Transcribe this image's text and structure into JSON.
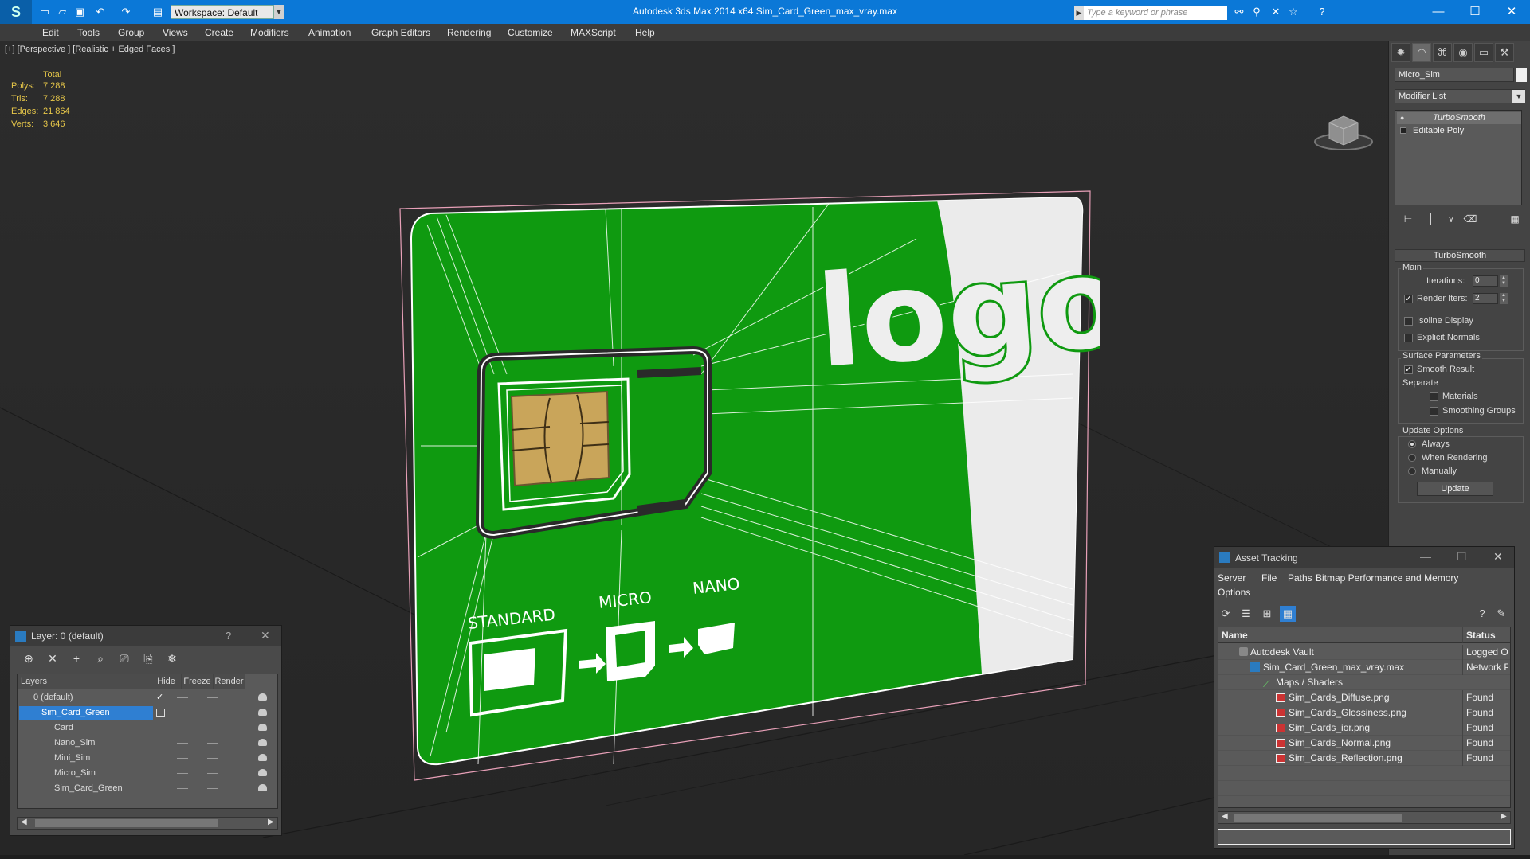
{
  "titlebar": {
    "workspace": "Workspace: Default",
    "title": "Autodesk 3ds Max  2014 x64      Sim_Card_Green_max_vray.max",
    "search_placeholder": "Type a keyword or phrase"
  },
  "menu": [
    "Edit",
    "Tools",
    "Group",
    "Views",
    "Create",
    "Modifiers",
    "Animation",
    "Graph Editors",
    "Rendering",
    "Customize",
    "MAXScript",
    "Help"
  ],
  "viewport": {
    "label": "[+] [Perspective ] [Realistic + Edged Faces ]",
    "stats": {
      "header": "Total",
      "rows": [
        {
          "label": "Polys:",
          "value": "7 288"
        },
        {
          "label": "Tris:",
          "value": "7 288"
        },
        {
          "label": "Edges:",
          "value": "21 864"
        },
        {
          "label": "Verts:",
          "value": "3 646"
        }
      ]
    },
    "card": {
      "logo_text": "logo",
      "standard_label": "STANDARD",
      "micro_label": "MICRO",
      "nano_label": "NANO",
      "green": "#0f9a10",
      "white": "#ebebeb"
    }
  },
  "command_panel": {
    "object_name": "Micro_Sim",
    "modifier_list": "Modifier List",
    "stack": [
      "TurboSmooth",
      "Editable Poly"
    ],
    "rollout_title": "TurboSmooth",
    "main_group": "Main",
    "iterations_label": "Iterations:",
    "iterations_value": "0",
    "render_iters_label": "Render Iters:",
    "render_iters_value": "2",
    "isoline_display": "Isoline Display",
    "explicit_normals": "Explicit Normals",
    "surface_params": "Surface Parameters",
    "smooth_result": "Smooth Result",
    "separate": "Separate",
    "materials": "Materials",
    "smoothing_groups": "Smoothing Groups",
    "update_options": "Update Options",
    "always": "Always",
    "when_rendering": "When Rendering",
    "manually": "Manually",
    "update_button": "Update"
  },
  "layer_dialog": {
    "title": "Layer: 0 (default)",
    "help": "?",
    "columns": {
      "layers": "Layers",
      "hide": "Hide",
      "freeze": "Freeze",
      "render": "Render"
    },
    "rows": [
      {
        "name": "0 (default)"
      },
      {
        "name": "Sim_Card_Green"
      },
      {
        "name": "Card"
      },
      {
        "name": "Nano_Sim"
      },
      {
        "name": "Mini_Sim"
      },
      {
        "name": "Micro_Sim"
      },
      {
        "name": "Sim_Card_Green"
      }
    ]
  },
  "asset_tracking": {
    "title": "Asset Tracking",
    "menu": [
      "Server",
      "File",
      "Paths",
      "Bitmap Performance and Memory"
    ],
    "menu2": "Options",
    "columns": {
      "name": "Name",
      "status": "Status"
    },
    "rows": [
      {
        "name": "Autodesk Vault",
        "status": "Logged Ou"
      },
      {
        "name": "Sim_Card_Green_max_vray.max",
        "status": "Network Pa"
      },
      {
        "name": "Maps / Shaders",
        "status": ""
      },
      {
        "name": "Sim_Cards_Diffuse.png",
        "status": "Found"
      },
      {
        "name": "Sim_Cards_Glossiness.png",
        "status": "Found"
      },
      {
        "name": "Sim_Cards_ior.png",
        "status": "Found"
      },
      {
        "name": "Sim_Cards_Normal.png",
        "status": "Found"
      },
      {
        "name": "Sim_Cards_Reflection.png",
        "status": "Found"
      }
    ]
  }
}
